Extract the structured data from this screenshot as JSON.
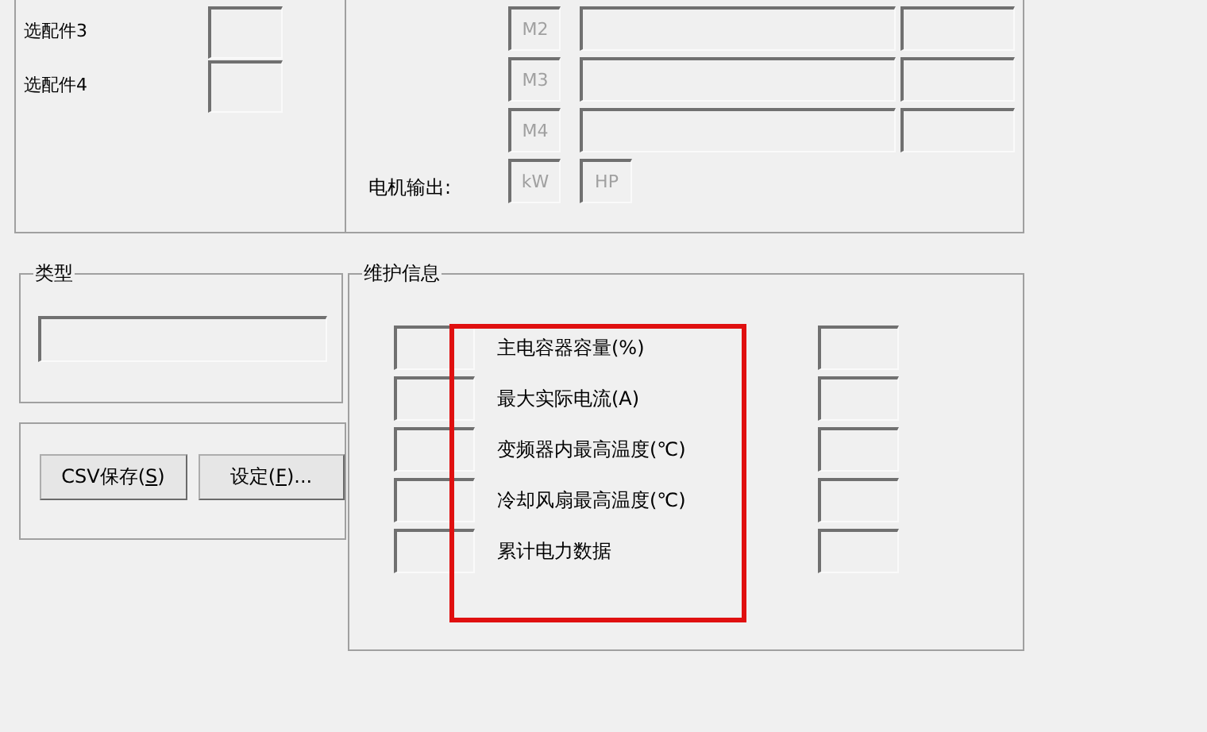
{
  "options_panel": {
    "rows": [
      {
        "label": "选配件3"
      },
      {
        "label": "选配件4"
      }
    ]
  },
  "motor_panel": {
    "motors": [
      {
        "label": "M2"
      },
      {
        "label": "M3"
      },
      {
        "label": "M4"
      }
    ],
    "output": {
      "label": "电机输出:",
      "units": [
        "kW",
        "HP"
      ]
    }
  },
  "type_group": {
    "title": "类型"
  },
  "buttons": [
    {
      "text_before": "CSV保存(",
      "access_key": "S",
      "text_after": ")"
    },
    {
      "text_before": "设定(",
      "access_key": "F",
      "text_after": ")..."
    }
  ],
  "maintenance": {
    "title": "维护信息",
    "highlight_frame": true,
    "items": [
      {
        "label": "主电容器容量(%)"
      },
      {
        "label": "最大实际电流(A)"
      },
      {
        "label": "变频器内最高温度(℃)"
      },
      {
        "label": "冷却风扇最高温度(℃)"
      },
      {
        "label": "累计电力数据"
      }
    ]
  }
}
